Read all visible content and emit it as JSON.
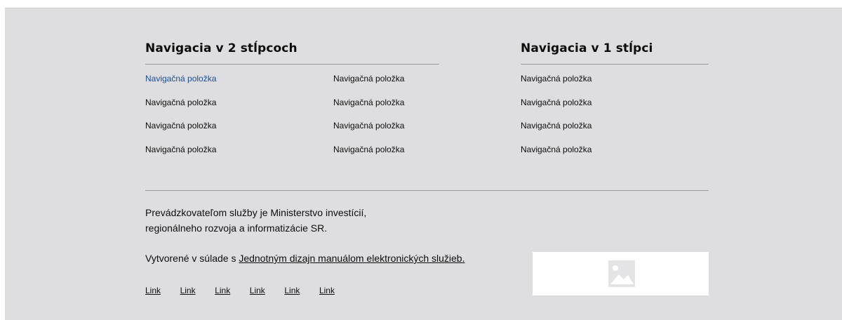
{
  "nav_two_col": {
    "title": "Navigacia v 2 stĺpcoch",
    "col1": [
      "Navigačná položka",
      "Navigačná položka",
      "Navigačná položka",
      "Navigačná položka"
    ],
    "col2": [
      "Navigačná položka",
      "Navigačná položka",
      "Navigačná položka",
      "Navigačná položka"
    ]
  },
  "nav_one_col": {
    "title": "Navigacia  v 1 stĺpci",
    "items": [
      "Navigačná položka",
      "Navigačná položka",
      "Navigačná položka",
      "Navigačná položka"
    ]
  },
  "about": {
    "line1": "Prevádzkovateľom služby je Ministerstvo investícií,",
    "line2": "regionálneho rozvoja a informatizácie SR."
  },
  "built_with": {
    "prefix": "Vytvorené v súlade s ",
    "link": "Jednotným dizajn manuálom elektronických služieb."
  },
  "links": [
    "Link",
    "Link",
    "Link",
    "Link",
    "Link",
    "Link"
  ],
  "colors": {
    "background": "#dedee0",
    "active_link": "#1d4d8f",
    "text": "#0b0c0c"
  },
  "logo": {
    "icon": "image-placeholder-icon"
  }
}
